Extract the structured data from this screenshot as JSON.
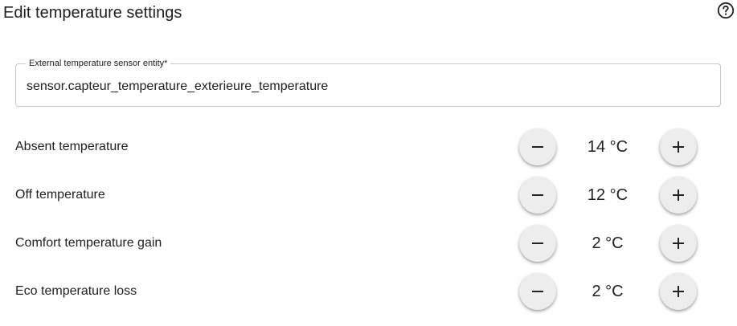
{
  "dialog": {
    "title": "Edit temperature settings",
    "help_icon": "help-circle-icon"
  },
  "sensor_field": {
    "label": "External temperature sensor entity*",
    "value": "sensor.capteur_temperature_exterieure_temperature"
  },
  "settings": [
    {
      "label": "Absent temperature",
      "value": "14 °C",
      "decrease_icon": "minus-icon",
      "increase_icon": "plus-icon"
    },
    {
      "label": "Off temperature",
      "value": "12 °C",
      "decrease_icon": "minus-icon",
      "increase_icon": "plus-icon"
    },
    {
      "label": "Comfort temperature gain",
      "value": "2 °C",
      "decrease_icon": "minus-icon",
      "increase_icon": "plus-icon"
    },
    {
      "label": "Eco temperature loss",
      "value": "2 °C",
      "decrease_icon": "minus-icon",
      "increase_icon": "plus-icon"
    }
  ]
}
